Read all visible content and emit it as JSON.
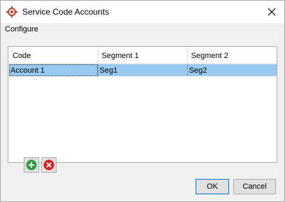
{
  "window": {
    "title": "Service Code Accounts"
  },
  "menu": [
    {
      "label": "Configure"
    }
  ],
  "grid": {
    "columns": [
      "Code",
      "Segment 1",
      "Segment 2"
    ],
    "rows": [
      {
        "code": "Account 1",
        "segment_1": "Seg1",
        "segment_2": "Seg2",
        "selected": true
      }
    ]
  },
  "icons": {
    "app": "target-gear-icon",
    "close": "close-icon",
    "add": "plus-circle-icon",
    "remove": "x-circle-icon"
  },
  "buttons": {
    "ok": "OK",
    "cancel": "Cancel"
  },
  "colors": {
    "selection": "#99c9ef",
    "add_green": "#2ea043",
    "remove_red": "#d92121",
    "app_icon_red": "#c0392b"
  }
}
